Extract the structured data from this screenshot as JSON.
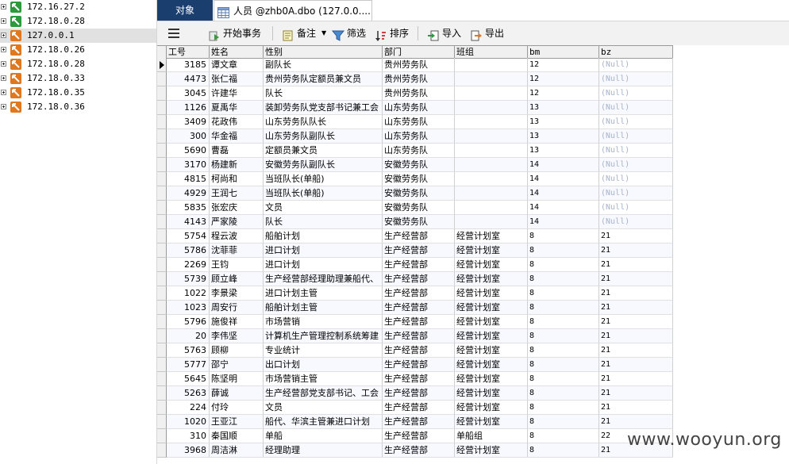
{
  "tree": {
    "connections": [
      {
        "label": "172.16.27.2",
        "icon": "connection-green-icon",
        "color": "#2a9a3a",
        "selected": false
      },
      {
        "label": "172.18.0.28",
        "icon": "connection-green-icon",
        "color": "#2a9a3a",
        "selected": false
      },
      {
        "label": "127.0.0.1",
        "icon": "connection-orange-icon",
        "color": "#e07820",
        "selected": true
      },
      {
        "label": "172.18.0.26",
        "icon": "connection-orange-icon",
        "color": "#e07820",
        "selected": false
      },
      {
        "label": "172.18.0.28",
        "icon": "connection-orange-icon",
        "color": "#e07820",
        "selected": false
      },
      {
        "label": "172.18.0.33",
        "icon": "connection-orange-icon",
        "color": "#e07820",
        "selected": false
      },
      {
        "label": "172.18.0.35",
        "icon": "connection-orange-icon",
        "color": "#e07820",
        "selected": false
      },
      {
        "label": "172.18.0.36",
        "icon": "connection-orange-icon",
        "color": "#e07820",
        "selected": false
      }
    ]
  },
  "tabs": {
    "objects": "对象",
    "table": "人员 @zhb0A.dbo (127.0.0...."
  },
  "toolbar": {
    "begin_transaction": "开始事务",
    "notes": "备注",
    "filter": "筛选",
    "sort": "排序",
    "import": "导入",
    "export": "导出"
  },
  "grid": {
    "columns": [
      "工号",
      "姓名",
      "性别",
      "部门",
      "班组",
      "bm",
      "bz"
    ],
    "null_text": "(Null)",
    "rows": [
      [
        "3185",
        "谭文章",
        "副队长",
        "贵州劳务队",
        "",
        "12",
        null
      ],
      [
        "4473",
        "张仁福",
        "贵州劳务队定额员兼文员",
        "贵州劳务队",
        "",
        "12",
        null
      ],
      [
        "3045",
        "许建华",
        "队长",
        "贵州劳务队",
        "",
        "12",
        null
      ],
      [
        "1126",
        "夏禹华",
        "装卸劳务队党支部书记兼工会",
        "山东劳务队",
        "",
        "13",
        null
      ],
      [
        "3409",
        "花政伟",
        "山东劳务队队长",
        "山东劳务队",
        "",
        "13",
        null
      ],
      [
        "300",
        "华金福",
        "山东劳务队副队长",
        "山东劳务队",
        "",
        "13",
        null
      ],
      [
        "5690",
        "曹磊",
        "定额员兼文员",
        "山东劳务队",
        "",
        "13",
        null
      ],
      [
        "3170",
        "杨建新",
        "安徽劳务队副队长",
        "安徽劳务队",
        "",
        "14",
        null
      ],
      [
        "4815",
        "柯尚和",
        "当班队长(单船)",
        "安徽劳务队",
        "",
        "14",
        null
      ],
      [
        "4929",
        "王润七",
        "当班队长(单船)",
        "安徽劳务队",
        "",
        "14",
        null
      ],
      [
        "5835",
        "张宏庆",
        "文员",
        "安徽劳务队",
        "",
        "14",
        null
      ],
      [
        "4143",
        "严家陵",
        "队长",
        "安徽劳务队",
        "",
        "14",
        null
      ],
      [
        "5754",
        "程云波",
        "船舶计划",
        "生产经营部",
        "经营计划室",
        "8",
        "21"
      ],
      [
        "5786",
        "沈菲菲",
        "进口计划",
        "生产经营部",
        "经营计划室",
        "8",
        "21"
      ],
      [
        "2269",
        "王钧",
        "进口计划",
        "生产经营部",
        "经营计划室",
        "8",
        "21"
      ],
      [
        "5739",
        "顾立峰",
        "生产经营部经理助理兼船代、",
        "生产经营部",
        "经营计划室",
        "8",
        "21"
      ],
      [
        "1022",
        "李景梁",
        "进口计划主管",
        "生产经营部",
        "经营计划室",
        "8",
        "21"
      ],
      [
        "1023",
        "周安行",
        "船舶计划主管",
        "生产经营部",
        "经营计划室",
        "8",
        "21"
      ],
      [
        "5796",
        "施俊祥",
        "市场营销",
        "生产经营部",
        "经营计划室",
        "8",
        "21"
      ],
      [
        "20",
        "李伟坚",
        "计算机生产管理控制系统筹建",
        "生产经营部",
        "经营计划室",
        "8",
        "21"
      ],
      [
        "5763",
        "顾柳",
        "专业统计",
        "生产经营部",
        "经营计划室",
        "8",
        "21"
      ],
      [
        "5777",
        "邵宁",
        "出口计划",
        "生产经营部",
        "经营计划室",
        "8",
        "21"
      ],
      [
        "5645",
        "陈坚明",
        "市场营销主管",
        "生产经营部",
        "经营计划室",
        "8",
        "21"
      ],
      [
        "5263",
        "薛诚",
        "生产经营部党支部书记、工会",
        "生产经营部",
        "经营计划室",
        "8",
        "21"
      ],
      [
        "224",
        "付玲",
        "文员",
        "生产经营部",
        "经营计划室",
        "8",
        "21"
      ],
      [
        "1020",
        "王亚江",
        "船代、华滨主管兼进口计划",
        "生产经营部",
        "经营计划室",
        "8",
        "21"
      ],
      [
        "310",
        "秦国顺",
        "单船",
        "生产经营部",
        "单船组",
        "8",
        "22"
      ],
      [
        "3968",
        "周洁淋",
        "经理助理",
        "生产经营部",
        "经营计划室",
        "8",
        "21"
      ]
    ]
  },
  "watermark": "www.wooyun.org"
}
